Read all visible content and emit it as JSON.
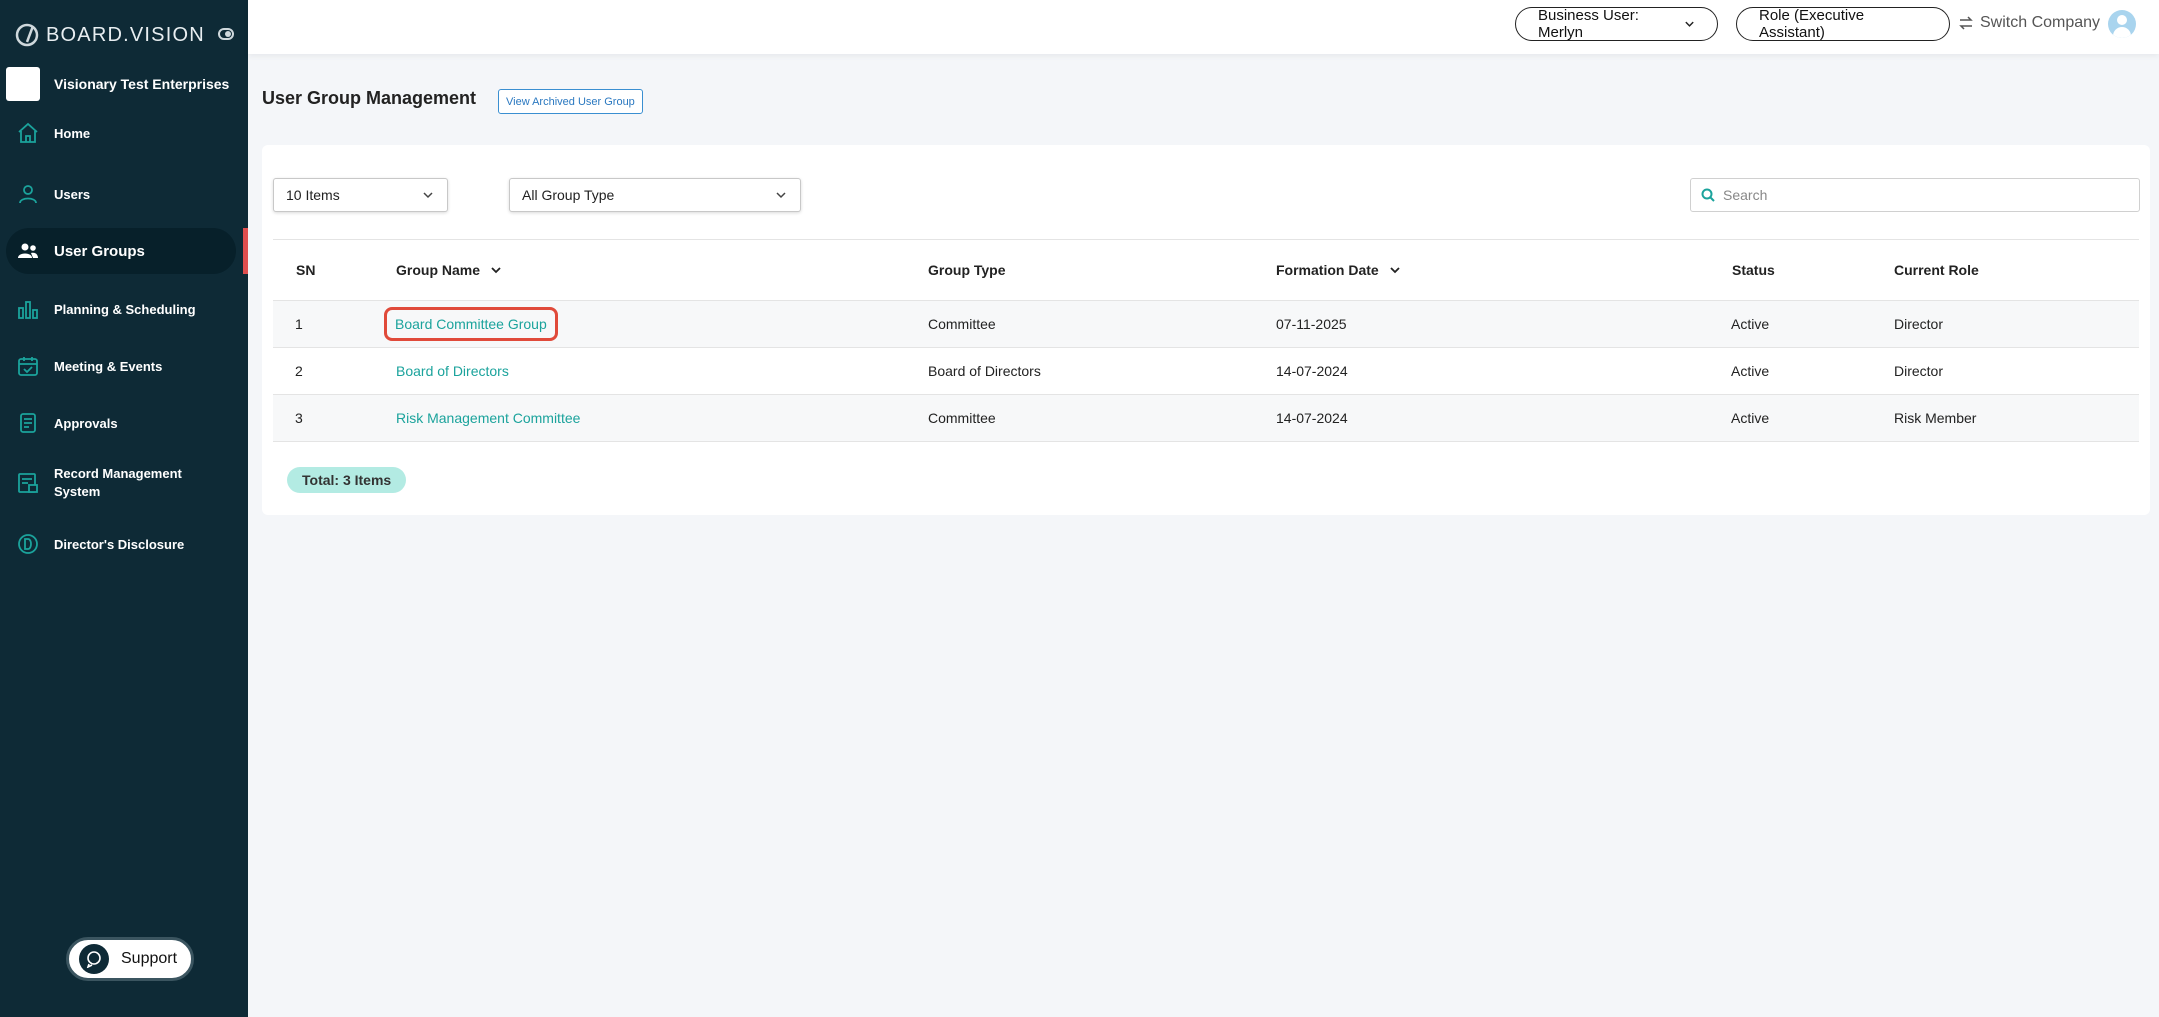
{
  "brand": {
    "name": "BOARD.VISION"
  },
  "company": {
    "name": "Visionary Test Enterprises"
  },
  "sidebar": {
    "items": [
      {
        "label": "Home",
        "icon": "home-icon"
      },
      {
        "label": "Users",
        "icon": "user-icon"
      },
      {
        "label": "User Groups",
        "icon": "users-icon",
        "active": true
      },
      {
        "label": "Planning & Scheduling",
        "icon": "bar-chart-icon"
      },
      {
        "label": "Meeting & Events",
        "icon": "calendar-check-icon"
      },
      {
        "label": "Approvals",
        "icon": "document-icon"
      },
      {
        "label": "Record Management System",
        "icon": "records-icon"
      },
      {
        "label": "Director's Disclosure",
        "icon": "d-circle-icon"
      }
    ],
    "support_label": "Support"
  },
  "topbar": {
    "business_user": "Business User: Merlyn",
    "role": "Role (Executive Assistant)",
    "switch_company": "Switch Company"
  },
  "main": {
    "title": "User Group Management",
    "archived_button": "View Archived User Group",
    "items_select": "10 Items",
    "group_type_select": "All Group Type",
    "search_placeholder": "Search",
    "columns": [
      "SN",
      "Group Name",
      "Group Type",
      "Formation Date",
      "Status",
      "Current Role"
    ],
    "rows": [
      {
        "sn": "1",
        "group_name": "Board Committee Group",
        "group_type": "Committee",
        "formation_date": "07-11-2025",
        "status": "Active",
        "current_role": "Director"
      },
      {
        "sn": "2",
        "group_name": "Board of Directors",
        "group_type": "Board of Directors",
        "formation_date": "14-07-2024",
        "status": "Active",
        "current_role": "Director"
      },
      {
        "sn": "3",
        "group_name": "Risk Management Committee",
        "group_type": "Committee",
        "formation_date": "14-07-2024",
        "status": "Active",
        "current_role": "Risk Member"
      }
    ],
    "total": "Total: 3 Items"
  },
  "colors": {
    "sidebar_bg": "#0e2a36",
    "accent": "#1ba39c",
    "active_marker": "#e04f4f",
    "highlight": "#e04a3a"
  }
}
